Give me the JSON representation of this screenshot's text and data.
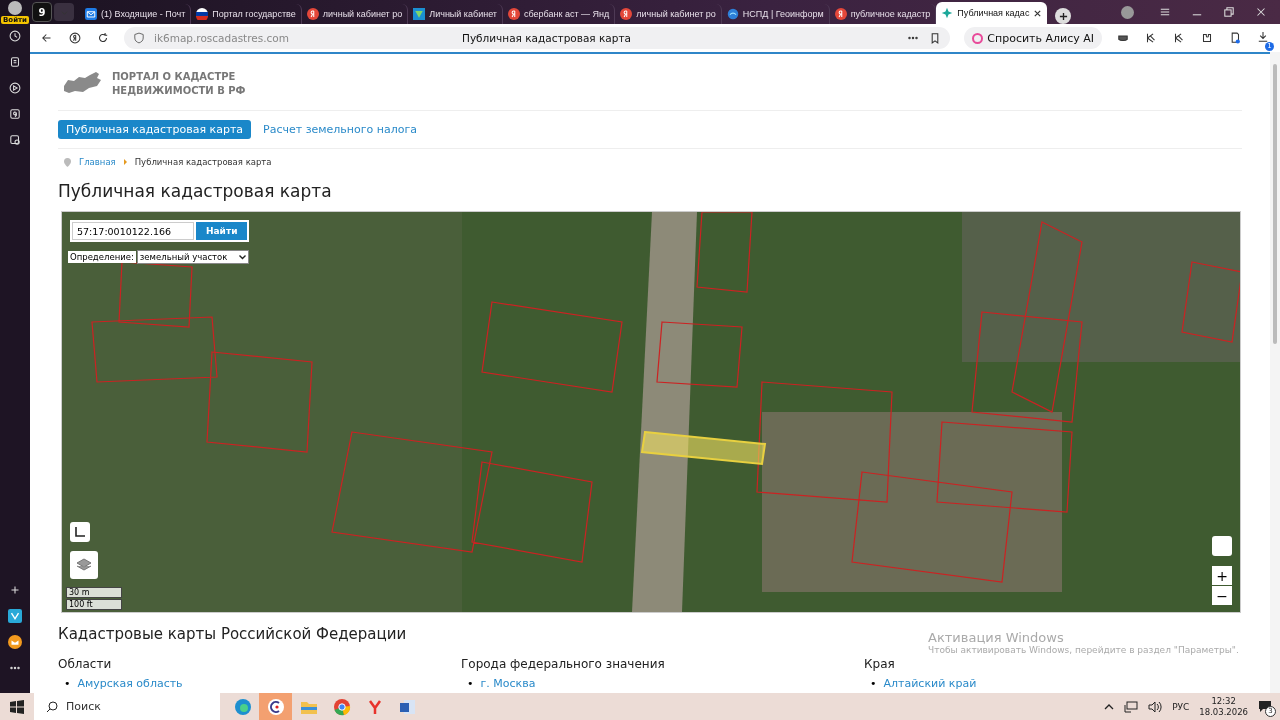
{
  "browser": {
    "profile_button": "Войти",
    "tab_counter": "9",
    "tabs": [
      {
        "title": "(1) Входящие - Почт",
        "kind": "mail",
        "selected": false
      },
      {
        "title": "Портал государстве",
        "kind": "flag",
        "selected": false
      },
      {
        "title": "личный кабинет ро",
        "kind": "yandex",
        "selected": false
      },
      {
        "title": "Личный кабинет",
        "kind": "tax",
        "selected": false
      },
      {
        "title": "сбербанк аст — Янд",
        "kind": "yandex",
        "selected": false
      },
      {
        "title": "личный кабинет ро",
        "kind": "yandex",
        "selected": false
      },
      {
        "title": "НСПД | Геоинформ",
        "kind": "geo",
        "selected": false
      },
      {
        "title": "публичное кадастр",
        "kind": "yandex",
        "selected": false
      },
      {
        "title": "Публичная кадас",
        "kind": "cadastre",
        "selected": true
      }
    ],
    "address": "ik6map.roscadastres.com",
    "page_title": "Публичная кадастровая карта",
    "alice_button": "Спросить Алису AI",
    "downloads_badge": "1"
  },
  "page": {
    "logo_lines": [
      "ПОРТАЛ О КАДАСТРЕ",
      "НЕДВИЖИМОСТИ В РФ"
    ],
    "nav": [
      {
        "label": "Публичная кадастровая карта",
        "selected": true
      },
      {
        "label": "Расчет земельного налога",
        "selected": false
      }
    ],
    "breadcrumbs": [
      "Главная",
      "Публичная кадастровая карта"
    ],
    "heading": "Публичная кадастровая карта",
    "map": {
      "search_value": "57:17:0010122.166",
      "search_button": "Найти",
      "definition_label": "Определение:",
      "definition_value": "земельный участок",
      "scale": [
        "30 m",
        "100 ft"
      ],
      "zoom_in": "+",
      "zoom_out": "−"
    },
    "section_heading": "Кадастровые карты Российской Федерации",
    "columns": [
      {
        "title": "Области",
        "links": [
          {
            "marker": "•",
            "label": "Амурская область"
          }
        ]
      },
      {
        "title": "Города федерального значения",
        "links": [
          {
            "marker": "•",
            "label": "г. Москва"
          }
        ]
      },
      {
        "title": "Края",
        "links": [
          {
            "marker": "•",
            "label": "Алтайский край"
          }
        ]
      }
    ]
  },
  "activation": {
    "title": "Активация Windows",
    "text": "Чтобы активировать Windows, перейдите в раздел \"Параметры\"."
  },
  "taskbar": {
    "search_placeholder": "Поиск",
    "language": "РУС",
    "time": "12:32",
    "date": "18.03.2026",
    "notifications": "3"
  }
}
